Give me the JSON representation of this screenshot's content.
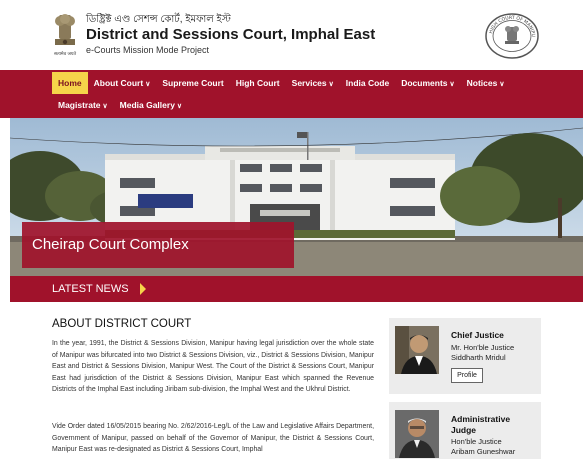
{
  "header": {
    "native_title": "ডিষ্ট্ৰিক্ট এণ্ড সেশন্স কোর্ট, ইমফাল ইস্ট",
    "title": "District and Sessions Court, Imphal East",
    "subtitle": "e-Courts Mission Mode Project",
    "emblem_caption": "सत्यमेव जयते",
    "seal_text": "HIGH COURT OF MANIPUR · IMPHAL"
  },
  "nav": {
    "row1": [
      {
        "label": "Home",
        "active": true,
        "dropdown": false
      },
      {
        "label": "About Court",
        "active": false,
        "dropdown": true
      },
      {
        "label": "Supreme Court",
        "active": false,
        "dropdown": false
      },
      {
        "label": "High Court",
        "active": false,
        "dropdown": false
      },
      {
        "label": "Services",
        "active": false,
        "dropdown": true
      },
      {
        "label": "India Code",
        "active": false,
        "dropdown": false
      },
      {
        "label": "Documents",
        "active": false,
        "dropdown": true
      },
      {
        "label": "Notices",
        "active": false,
        "dropdown": true
      }
    ],
    "row2": [
      {
        "label": "Magistrate",
        "active": false,
        "dropdown": true
      },
      {
        "label": "Media Gallery",
        "active": false,
        "dropdown": true
      }
    ]
  },
  "banner": {
    "caption": "Cheirap Court Complex"
  },
  "news": {
    "label": "LATEST NEWS"
  },
  "about": {
    "title": "ABOUT DISTRICT COURT",
    "paragraph1": "In the year, 1991, the District & Sessions Division, Manipur having legal jurisdiction over the whole state of Manipur was bifurcated into two District & Sessions Division, viz., District & Sessions Division, Manipur East and District & Sessions Division, Manipur West. The Court of the District & Sessions Court, Manipur East had jurisdiction of the District & Sessions Division, Manipur East which spanned the Revenue Districts of the Imphal East including Jiribam sub-division, the Imphal West and the Ukhrul District.",
    "paragraph2": "Vide Order dated 16/05/2015 bearing No. 2/62/2016-Leg/L of the Law and Legislative Affairs Department, Government of Manipur, passed on behalf of the Governor of Manipur, the District & Sessions Court, Manipur East was re-designated as District & Sessions Court, Imphal"
  },
  "cards": [
    {
      "role": "Chief Justice",
      "name_lines": [
        "Mr. Hon'ble Justice",
        "Siddharth Mridul"
      ],
      "button": "Profile"
    },
    {
      "role": "Administrative Judge",
      "name_lines": [
        "Hon'ble Justice",
        "Aribam Guneshwar"
      ],
      "button": ""
    }
  ],
  "colors": {
    "primary": "#a0122b",
    "accent": "#f6d44a"
  }
}
